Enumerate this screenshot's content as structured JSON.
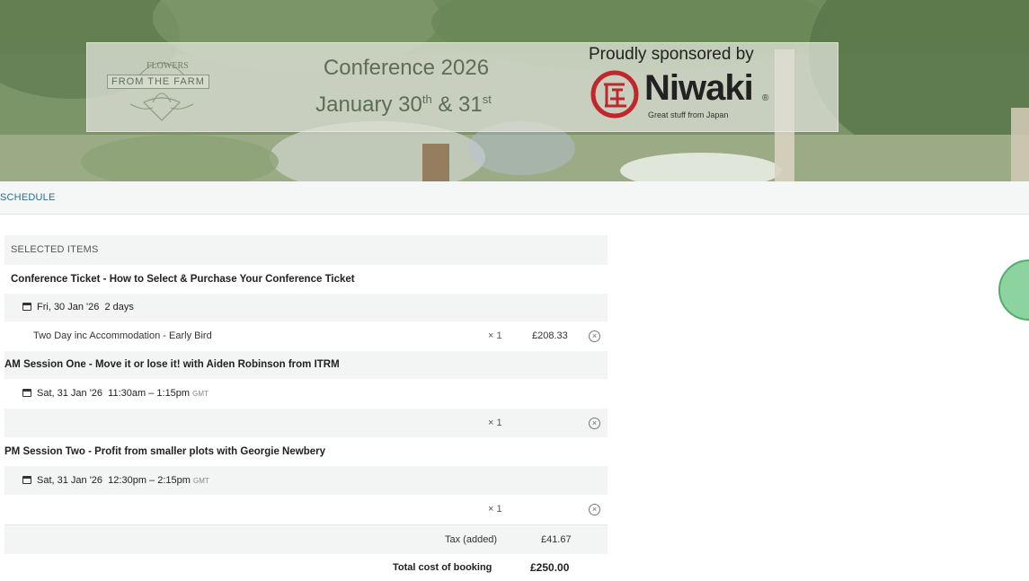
{
  "banner": {
    "logo_text": "FROM THE FARM",
    "logo_arc": "FLOWERS",
    "conference_title": "Conference 2026",
    "date_prefix": "January 30",
    "date_sup1": "th",
    "date_mid": " & 31",
    "date_sup2": "st",
    "sponsor_line": "Proudly sponsored by",
    "sponsor_name": "Niwaki",
    "sponsor_reg": "®",
    "sponsor_tagline": "Great stuff from Japan"
  },
  "nav": {
    "items": [
      "SCHEDULE"
    ]
  },
  "cart": {
    "section_label": "SELECTED ITEMS",
    "items": [
      {
        "title": "Conference Ticket - How to Select & Purchase Your Conference Ticket",
        "date": "Fri, 30 Jan '26",
        "time": "2 days",
        "tz": "",
        "line_label": "Two Day inc Accommodation - Early Bird",
        "qty": "× 1",
        "price": "£208.33"
      },
      {
        "title": "AM Session One - Move it or lose it! with Aiden Robinson from ITRM",
        "date": "Sat, 31 Jan '26",
        "time": "11:30am – 1:15pm",
        "tz": "GMT",
        "line_label": "",
        "qty": "× 1",
        "price": ""
      },
      {
        "title": "PM Session Two - Profit from smaller plots with Georgie Newbery",
        "date": "Sat, 31 Jan '26",
        "time": "12:30pm – 2:15pm",
        "tz": "GMT",
        "line_label": "",
        "qty": "× 1",
        "price": ""
      }
    ],
    "tax_label": "Tax (added)",
    "tax_value": "£41.67",
    "total_label": "Total cost of booking",
    "total_value": "£250.00"
  },
  "icons": {
    "calendar": "calendar-icon",
    "remove": "remove-circle-icon"
  },
  "colors": {
    "nav_link": "#2f6a8a",
    "bubble": "#8dd3a0",
    "bubble_border": "#4fae6b"
  }
}
